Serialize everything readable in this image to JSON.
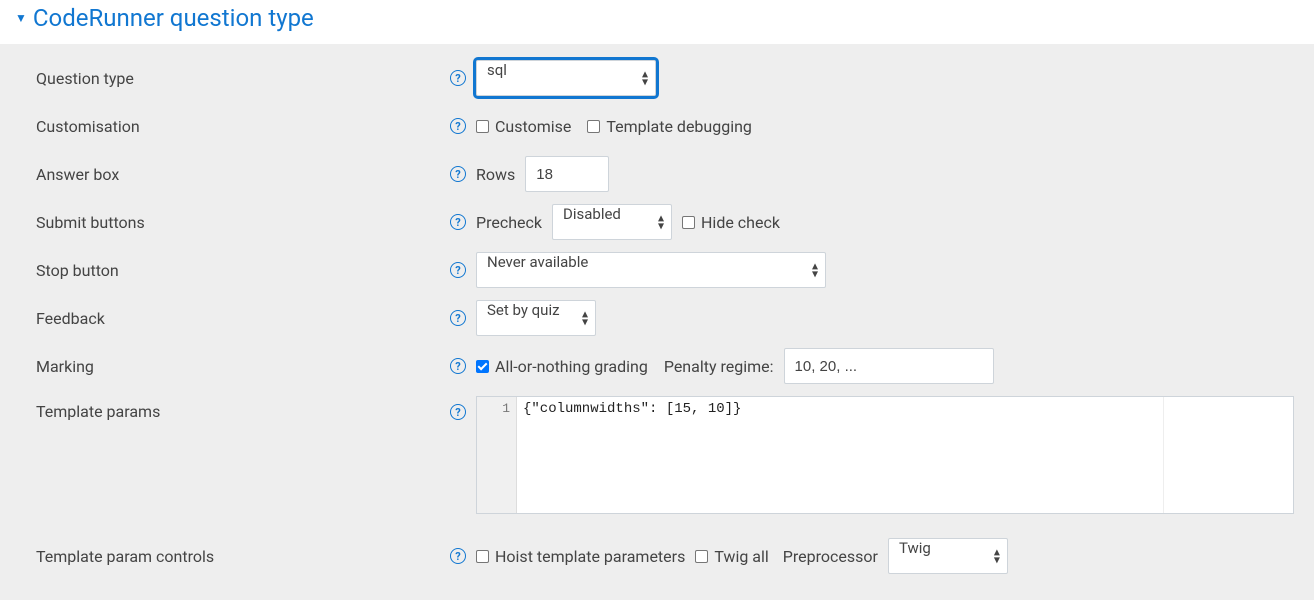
{
  "section": {
    "title": "CodeRunner question type"
  },
  "labels": {
    "question_type": "Question type",
    "customisation": "Customisation",
    "answer_box": "Answer box",
    "submit_buttons": "Submit buttons",
    "stop_button": "Stop button",
    "feedback": "Feedback",
    "marking": "Marking",
    "template_params": "Template params",
    "template_param_controls": "Template param controls"
  },
  "question_type": {
    "value": "sql"
  },
  "customisation": {
    "customise_label": "Customise",
    "template_debugging_label": "Template debugging"
  },
  "answer_box": {
    "rows_label": "Rows",
    "rows_value": "18"
  },
  "submit_buttons": {
    "precheck_label": "Precheck",
    "precheck_value": "Disabled",
    "hide_check_label": "Hide check"
  },
  "stop_button": {
    "value": "Never available"
  },
  "feedback": {
    "value": "Set by quiz"
  },
  "marking": {
    "all_or_nothing_label": "All-or-nothing grading",
    "penalty_regime_label": "Penalty regime:",
    "penalty_regime_value": "10, 20, ..."
  },
  "template_params": {
    "line_number": "1",
    "code": "{\"columnwidths\": [15, 10]}"
  },
  "template_param_controls": {
    "hoist_label": "Hoist template parameters",
    "twig_all_label": "Twig all",
    "preprocessor_label": "Preprocessor",
    "preprocessor_value": "Twig"
  }
}
